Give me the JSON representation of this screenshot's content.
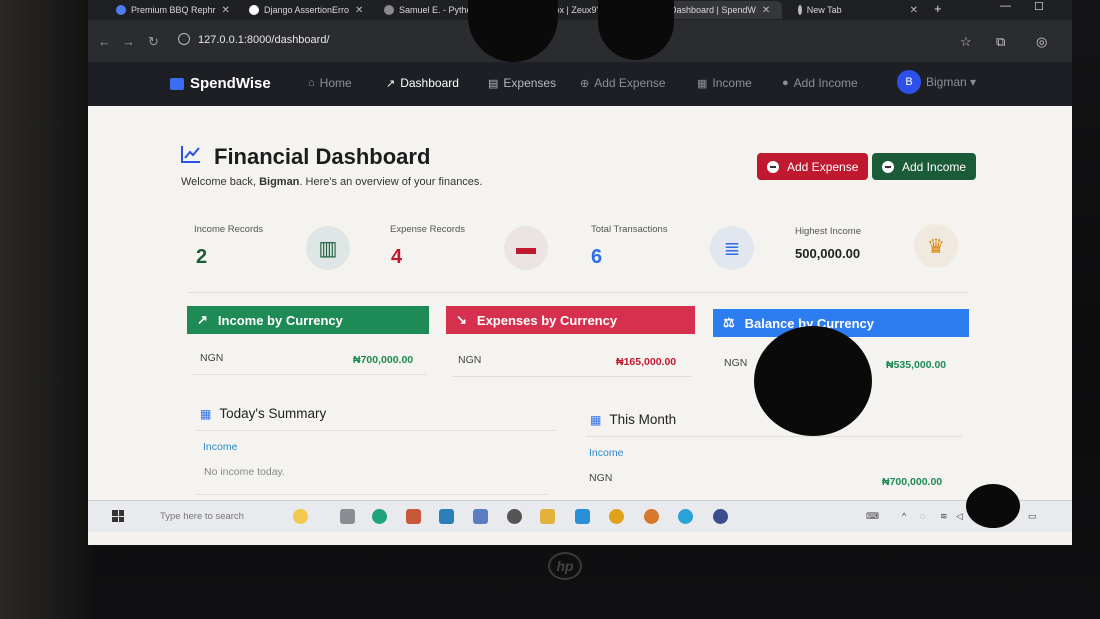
{
  "browser": {
    "tabs": [
      {
        "label": "Premium BBQ Rephr",
        "color": "#4f7cf0"
      },
      {
        "label": "Django AssertionErro",
        "color": "#ffffff"
      },
      {
        "label": "Samuel E. - Python I",
        "color": "#8a8a8a"
      },
      {
        "label": "Inbox | Zeux9'",
        "color": "#d44638"
      },
      {
        "label": "Dashboard | SpendW",
        "color": "#8a8a8a"
      },
      {
        "label": "New Tab",
        "color": "#bbbbbb"
      }
    ],
    "url": "127.0.0.1:8000/dashboard/"
  },
  "navbar": {
    "brand": "SpendWise",
    "links": [
      {
        "label": "Home",
        "icon": "home-icon"
      },
      {
        "label": "Dashboard",
        "icon": "chart-line-icon"
      },
      {
        "label": "Expenses",
        "icon": "file-icon"
      },
      {
        "label": "Add Expense",
        "icon": "plus-circle-icon"
      },
      {
        "label": "Income",
        "icon": "building-icon"
      },
      {
        "label": "Add Income",
        "icon": "user-plus-icon"
      }
    ],
    "avatar_initial": "B",
    "username": "Bigman"
  },
  "header": {
    "title": "Financial Dashboard",
    "welcome_prefix": "Welcome back,",
    "welcome_name": "Bigman",
    "welcome_suffix": ". Here's an overview of your finances.",
    "add_expense_label": "Add Expense",
    "add_income_label": "Add Income"
  },
  "stats": [
    {
      "label": "Income Records",
      "value": "2",
      "color": "#1b5b38",
      "icon": "money-bills-icon"
    },
    {
      "label": "Expense Records",
      "value": "4",
      "color": "#c0192f",
      "icon": "wallet-icon"
    },
    {
      "label": "Total Transactions",
      "value": "6",
      "color": "#2d6fe8",
      "icon": "receipt-icon"
    },
    {
      "label": "Highest Income",
      "value": "500,000.00",
      "color": "#222222",
      "icon": "trophy-icon"
    }
  ],
  "currency_panels": [
    {
      "title": "Income by Currency",
      "code": "NGN",
      "amount": "₦700,000.00",
      "color": "#1e8a55",
      "amount_color": "#1e8a55",
      "icon": "trend-up-icon"
    },
    {
      "title": "Expenses by Currency",
      "code": "NGN",
      "amount": "₦165,000.00",
      "color": "#d6304f",
      "amount_color": "#c0192f",
      "icon": "trend-down-icon"
    },
    {
      "title": "Balance by Currency",
      "code": "NGN",
      "amount": "₦535,000.00",
      "color": "#2d7cf0",
      "amount_color": "#1e8a55",
      "icon": "scale-icon"
    }
  ],
  "today": {
    "title": "Today's Summary",
    "income_label": "Income",
    "empty_text": "No income today."
  },
  "month": {
    "title": "This Month",
    "income_label": "Income",
    "code": "NGN",
    "amount": "₦700,000.00"
  },
  "taskbar": {
    "search_placeholder": "Type here to search"
  }
}
